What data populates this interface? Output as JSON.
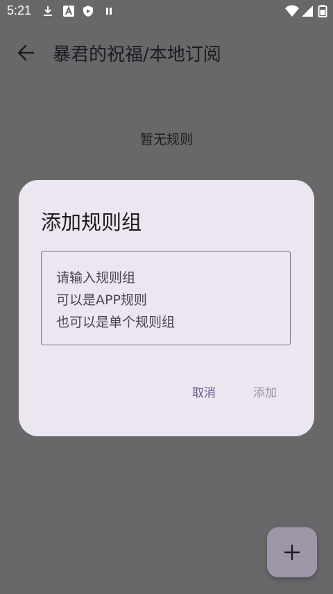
{
  "status_bar": {
    "time": "5:21",
    "left_icons": [
      "download-icon",
      "font-a-icon",
      "shield-icon",
      "pause-icon"
    ],
    "right_icons": [
      "wifi-icon",
      "signal-icon",
      "battery-icon"
    ]
  },
  "app_bar": {
    "title": "暴君的祝福/本地订阅",
    "back_icon": "arrow-back-icon"
  },
  "main": {
    "empty_text": "暂无规则"
  },
  "dialog": {
    "title": "添加规则组",
    "input": {
      "value": "",
      "placeholder": "请输入规则组\n可以是APP规则\n也可以是单个规则组"
    },
    "cancel_label": "取消",
    "confirm_label": "添加"
  },
  "fab": {
    "icon": "plus-icon"
  },
  "colors": {
    "scrim_background": "#686769",
    "dialog_surface": "#ece6f0",
    "primary": "#65558f",
    "disabled_text": "#9a97a0",
    "fab_container": "#e8def8"
  }
}
